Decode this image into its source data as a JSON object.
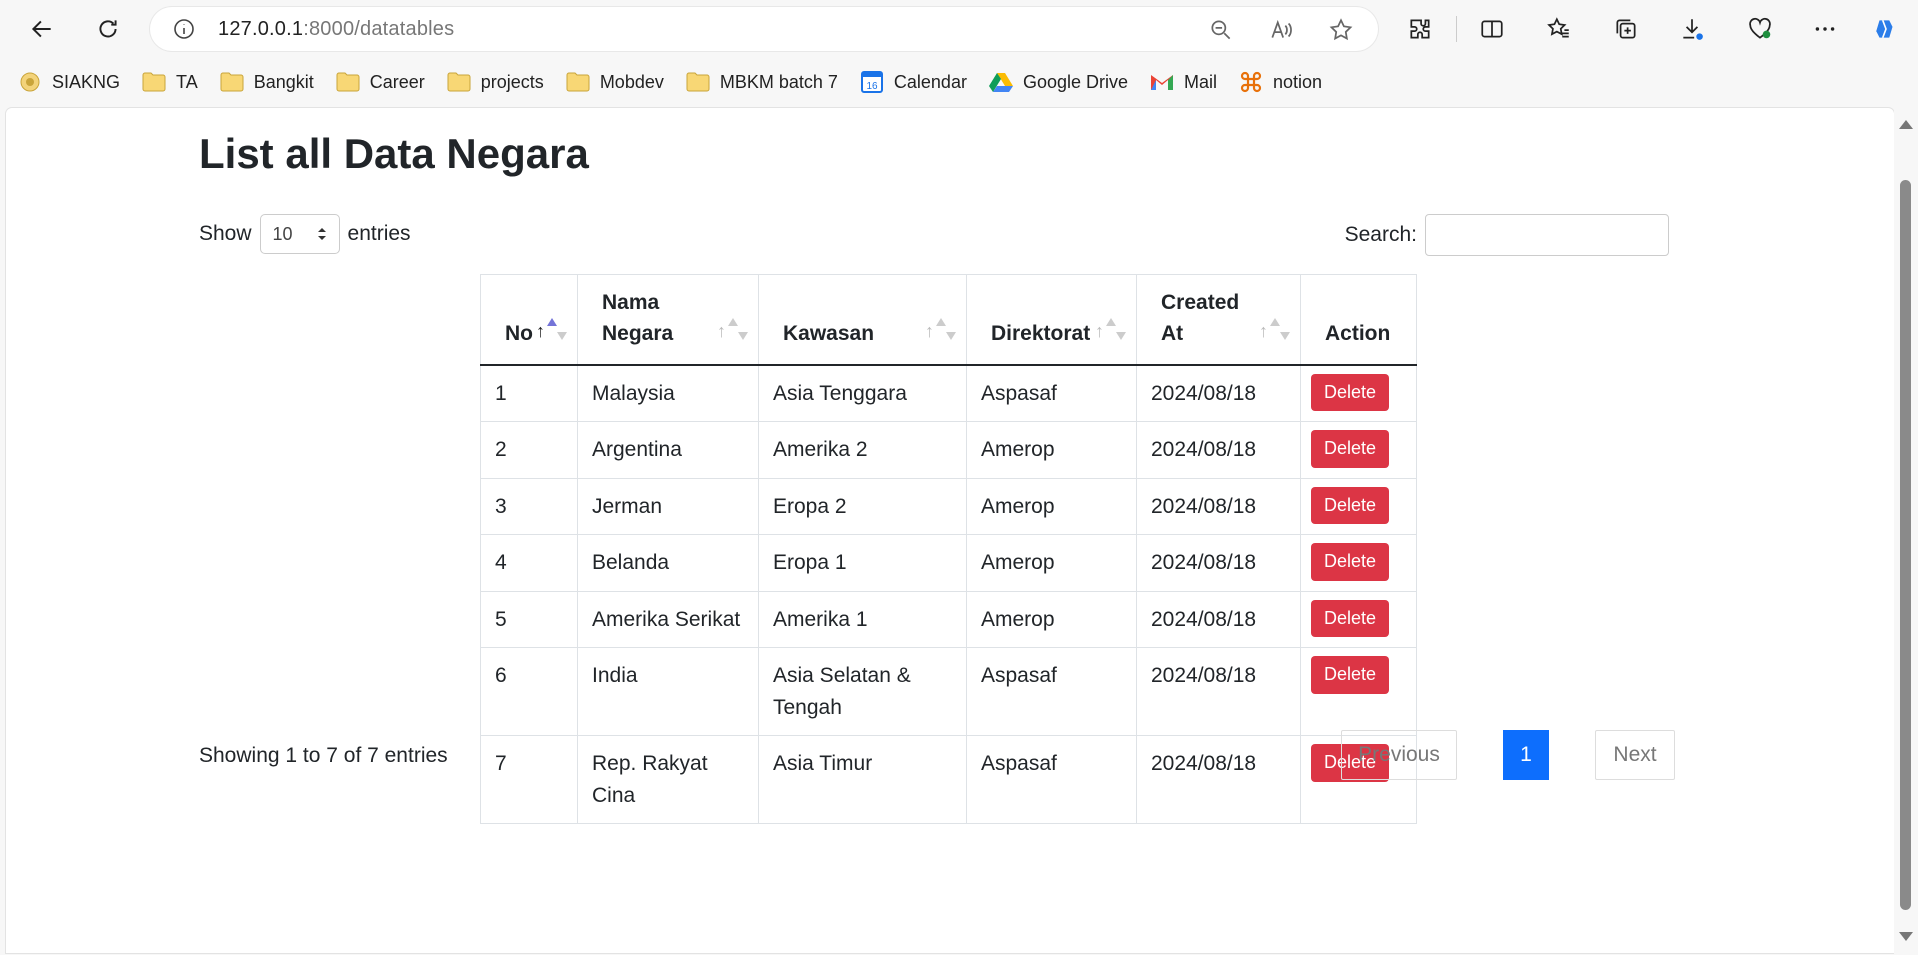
{
  "browser": {
    "url_host": "127.0.0.1",
    "url_rest": ":8000/datatables",
    "bookmarks": [
      {
        "label": "SIAKNG",
        "icon": "seal-icon"
      },
      {
        "label": "TA",
        "icon": "folder-icon"
      },
      {
        "label": "Bangkit",
        "icon": "folder-icon"
      },
      {
        "label": "Career",
        "icon": "folder-icon"
      },
      {
        "label": "projects",
        "icon": "folder-icon"
      },
      {
        "label": "Mobdev",
        "icon": "folder-icon"
      },
      {
        "label": "MBKM batch 7",
        "icon": "folder-icon"
      },
      {
        "label": "Calendar",
        "icon": "calendar-icon"
      },
      {
        "label": "Google Drive",
        "icon": "google-drive-icon"
      },
      {
        "label": "Mail",
        "icon": "gmail-icon"
      },
      {
        "label": "notion",
        "icon": "notion-icon"
      }
    ]
  },
  "page": {
    "title": "List all Data Negara",
    "length": {
      "show": "Show",
      "value": "10",
      "entries": "entries"
    },
    "search_label": "Search:",
    "columns": [
      "No",
      "Nama Negara",
      "Kawasan",
      "Direktorat",
      "Created At",
      "Action"
    ],
    "rows": [
      {
        "no": "1",
        "nama": "Malaysia",
        "kawasan": "Asia Tenggara",
        "direktorat": "Aspasaf",
        "created": "2024/08/18",
        "action": "Delete"
      },
      {
        "no": "2",
        "nama": "Argentina",
        "kawasan": "Amerika 2",
        "direktorat": "Amerop",
        "created": "2024/08/18",
        "action": "Delete"
      },
      {
        "no": "3",
        "nama": "Jerman",
        "kawasan": "Eropa 2",
        "direktorat": "Amerop",
        "created": "2024/08/18",
        "action": "Delete"
      },
      {
        "no": "4",
        "nama": "Belanda",
        "kawasan": "Eropa 1",
        "direktorat": "Amerop",
        "created": "2024/08/18",
        "action": "Delete"
      },
      {
        "no": "5",
        "nama": "Amerika Serikat",
        "kawasan": "Amerika 1",
        "direktorat": "Amerop",
        "created": "2024/08/18",
        "action": "Delete"
      },
      {
        "no": "6",
        "nama": "India",
        "kawasan": "Asia Selatan & Tengah",
        "direktorat": "Aspasaf",
        "created": "2024/08/18",
        "action": "Delete"
      },
      {
        "no": "7",
        "nama": "Rep. Rakyat Cina",
        "kawasan": "Asia Timur",
        "direktorat": "Aspasaf",
        "created": "2024/08/18",
        "action": "Delete"
      }
    ],
    "info": "Showing 1 to 7 of 7 entries",
    "pagination": {
      "previous": "Previous",
      "current": "1",
      "next": "Next"
    }
  },
  "colors": {
    "delete": "#dc3545",
    "page_active": "#0d6efd"
  }
}
